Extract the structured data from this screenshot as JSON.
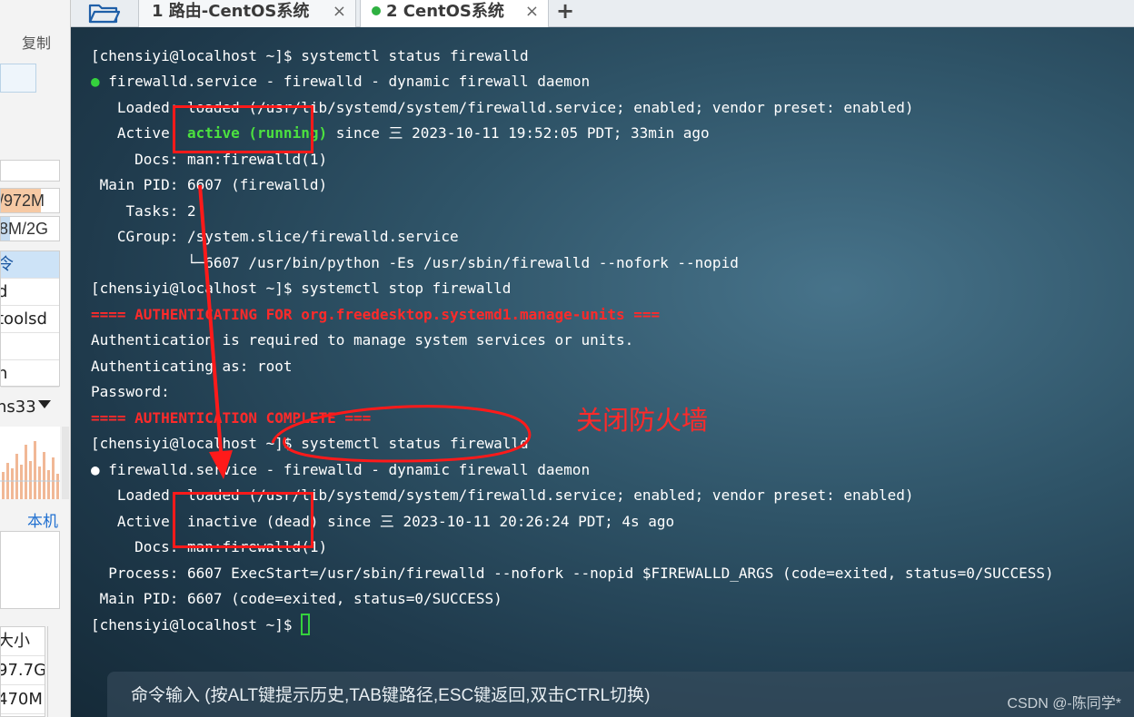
{
  "sidebar": {
    "copy_label": "复制",
    "mem1": "/972M",
    "mem2": "8M/2G",
    "process_rows": [
      "令",
      "d",
      "toolsd",
      "",
      "h"
    ],
    "net_label": "ns33",
    "local_label": "本机",
    "disk_rows": [
      "大小",
      "97.7G",
      "470M"
    ]
  },
  "tabs": [
    {
      "label": "1 路由-CentOS系统",
      "close": "×"
    },
    {
      "label": "2 CentOS系统",
      "close": "×",
      "status_color": "#2fb141"
    }
  ],
  "add_tab_label": "+",
  "terminal": {
    "lines": [
      {
        "id": "l1",
        "text": "[chensiyi@localhost ~]$ systemctl status firewalld"
      },
      {
        "id": "l2a",
        "text": "●"
      },
      {
        "id": "l2b",
        "text": " firewalld.service - firewalld - dynamic firewall daemon"
      },
      {
        "id": "l3",
        "text": "   Loaded: loaded (/usr/lib/systemd/system/firewalld.service; enabled; vendor preset: enabled)"
      },
      {
        "id": "l4a",
        "text": "   Active: "
      },
      {
        "id": "l4b",
        "text": "active (running)"
      },
      {
        "id": "l4c",
        "text": " since 三 2023-10-11 19:52:05 PDT; 33min ago"
      },
      {
        "id": "l5",
        "text": "     Docs: man:firewalld(1)"
      },
      {
        "id": "l6",
        "text": " Main PID: 6607 (firewalld)"
      },
      {
        "id": "l7",
        "text": "    Tasks: 2"
      },
      {
        "id": "l8",
        "text": "   CGroup: /system.slice/firewalld.service"
      },
      {
        "id": "l9",
        "text": "           └─6607 /usr/bin/python -Es /usr/sbin/firewalld --nofork --nopid"
      },
      {
        "id": "l10",
        "text": "[chensiyi@localhost ~]$ systemctl stop firewalld"
      },
      {
        "id": "l11",
        "text": "==== AUTHENTICATING FOR org.freedesktop.systemd1.manage-units ==="
      },
      {
        "id": "l12",
        "text": "Authentication is required to manage system services or units."
      },
      {
        "id": "l13",
        "text": "Authenticating as: root"
      },
      {
        "id": "l14",
        "text": "Password:"
      },
      {
        "id": "l15",
        "text": "==== AUTHENTICATION COMPLETE ==="
      },
      {
        "id": "l16",
        "text": "[chensiyi@localhost ~]$ systemctl status firewalld"
      },
      {
        "id": "l17",
        "text": "● firewalld.service - firewalld - dynamic firewall daemon"
      },
      {
        "id": "l18",
        "text": "   Loaded: loaded (/usr/lib/systemd/system/firewalld.service; enabled; vendor preset: enabled)"
      },
      {
        "id": "l19",
        "text": "   Active: inactive (dead) since 三 2023-10-11 20:26:24 PDT; 4s ago"
      },
      {
        "id": "l20",
        "text": "     Docs: man:firewalld(1)"
      },
      {
        "id": "l21",
        "text": "  Process: 6607 ExecStart=/usr/sbin/firewalld --nofork --nopid $FIREWALLD_ARGS (code=exited, status=0/SUCCESS)"
      },
      {
        "id": "l22",
        "text": " Main PID: 6607 (code=exited, status=0/SUCCESS)"
      },
      {
        "id": "l23",
        "text": "[chensiyi@localhost ~]$ "
      }
    ],
    "annotation_label": "关闭防火墙",
    "command_hint": "命令输入 (按ALT键提示历史,TAB键路径,ESC键返回,双击CTRL切换)",
    "watermark": "CSDN @-陈同学*"
  },
  "colors": {
    "annotation": "#ff1a1a",
    "active_green": "#4ce13f",
    "auth_red": "#ff2a2a"
  }
}
